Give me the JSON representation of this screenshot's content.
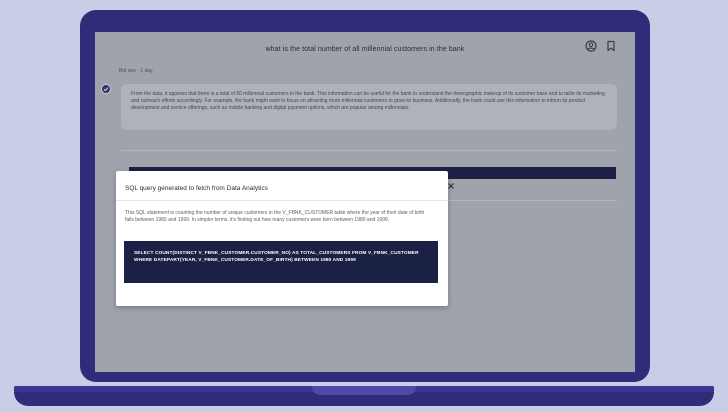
{
  "chat": {
    "question": "what is the total number of all millennial customers in the bank",
    "meta": "Bot ans · 1 day",
    "answer": "From the data, it appears that there is a total of 60 millennial customers in the bank. This information can be useful for the bank to understand the demographic makeup of its customer base and to tailor its marketing and outreach efforts accordingly. For example, the bank might want to focus on attracting more millennial customers to grow its business. Additionally, the bank could use this information to inform its product development and service offerings, such as mobile banking and digital payment options, which are popular among millennials."
  },
  "modal": {
    "title": "SQL query generated to fetch from Data Analytics",
    "description": "This SQL statement is counting the number of unique customers in the V_FBNK_CUSTOMER table where the year of their date of birth falls between 1980 and 1999. In simpler terms, it's finding out how many customers were born between 1980 and 1999.",
    "sql": "SELECT COUNT(DISTINCT V_FBNK_CUSTOMER.CUSTOMER_NO) AS TOTAL_CUSTOMERS FROM V_FBNK_CUSTOMER WHERE DATEPART(YEAR, V_FBNK_CUSTOMER.DATE_OF_BIRTH) BETWEEN 1980 AND 1999"
  },
  "icons": {
    "account": "account-circle-icon",
    "bookmark": "bookmark-icon",
    "close": "close-icon",
    "bot": "bot-avatar-icon"
  },
  "colors": {
    "laptop": "#2f2c7a",
    "background": "#c9cde6",
    "sql_box": "#1b2045",
    "overlay_screen": "#9fa3ac"
  }
}
